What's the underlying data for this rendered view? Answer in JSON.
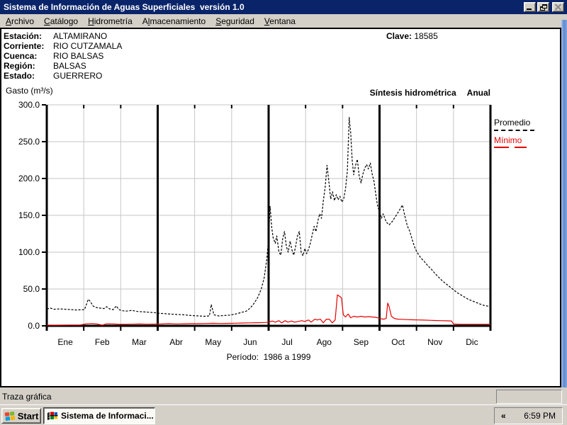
{
  "titlebar": {
    "title": "Sistema de Información de Aguas Superficiales  versión 1.0"
  },
  "menu": {
    "items": [
      {
        "label": "Archivo",
        "mnemonic": 0
      },
      {
        "label": "Catálogo",
        "mnemonic": 0
      },
      {
        "label": "Hidrometría",
        "mnemonic": 0
      },
      {
        "label": "Almacenamiento",
        "mnemonic": 1
      },
      {
        "label": "Seguridad",
        "mnemonic": 0
      },
      {
        "label": "Ventana",
        "mnemonic": 0
      }
    ]
  },
  "info": {
    "fields": [
      {
        "label": "Estación:",
        "value": "ALTAMIRANO"
      },
      {
        "label": "Corriente:",
        "value": "RIO CUTZAMALA"
      },
      {
        "label": "Cuenca:",
        "value": "RIO BALSAS"
      },
      {
        "label": "Región:",
        "value": "BALSAS"
      },
      {
        "label": "Estado:",
        "value": "GUERRERO"
      }
    ],
    "clave_label": "Clave:",
    "clave_value": "18585"
  },
  "chart": {
    "y_axis_title": "Gasto (m³/s)",
    "header_title": "Síntesis hidrométrica",
    "header_mode": "Anual",
    "period": "Período:  1986 a 1999",
    "legend_promedio": "Promedio",
    "legend_minimo": "Mínimo"
  },
  "chart_data": {
    "type": "line",
    "title": "Síntesis hidrométrica Anual",
    "ylabel": "Gasto (m³/s)",
    "xlabel": "",
    "ylim": [
      0,
      300
    ],
    "y_tick_values": [
      300,
      250,
      200,
      150,
      100,
      50,
      0
    ],
    "y_tick_labels": [
      "300.0",
      "250.0",
      "200.0",
      "150.0",
      "100.0",
      "50.0",
      "0.0"
    ],
    "categories": [
      "Ene",
      "Feb",
      "Mar",
      "Abr",
      "May",
      "Jun",
      "Jul",
      "Ago",
      "Sep",
      "Oct",
      "Nov",
      "Dic"
    ],
    "x_unit": "month, fractional 0-12",
    "quarter_separators": [
      3,
      6,
      9
    ],
    "grid": true,
    "legend_position": "right",
    "annotation": "Período: 1986 a 1999",
    "colors": {
      "promedio": "#000000",
      "minimo": "#e60000",
      "grid": "#c6c6c6"
    },
    "series": [
      {
        "name": "Promedio",
        "color": "#000000",
        "line_style": "dashed",
        "points": [
          [
            0.0,
            23
          ],
          [
            0.1,
            24
          ],
          [
            0.2,
            22.5
          ],
          [
            0.35,
            23
          ],
          [
            0.5,
            22.5
          ],
          [
            0.65,
            22
          ],
          [
            0.8,
            21.5
          ],
          [
            0.95,
            21.8
          ],
          [
            1.02,
            22
          ],
          [
            1.08,
            30
          ],
          [
            1.12,
            36
          ],
          [
            1.18,
            33
          ],
          [
            1.25,
            27
          ],
          [
            1.32,
            25
          ],
          [
            1.45,
            24
          ],
          [
            1.55,
            23.5
          ],
          [
            1.62,
            26
          ],
          [
            1.7,
            23
          ],
          [
            1.8,
            22
          ],
          [
            1.88,
            27
          ],
          [
            1.95,
            22
          ],
          [
            2.05,
            20.5
          ],
          [
            2.15,
            20
          ],
          [
            2.3,
            21
          ],
          [
            2.45,
            19.5
          ],
          [
            2.6,
            19
          ],
          [
            2.75,
            18.5
          ],
          [
            2.9,
            18
          ],
          [
            3.05,
            17
          ],
          [
            3.2,
            16.5
          ],
          [
            3.35,
            16
          ],
          [
            3.5,
            15.5
          ],
          [
            3.7,
            15
          ],
          [
            3.9,
            14
          ],
          [
            4.1,
            13.5
          ],
          [
            4.25,
            13
          ],
          [
            4.4,
            13.5
          ],
          [
            4.45,
            29
          ],
          [
            4.52,
            15
          ],
          [
            4.65,
            13.5
          ],
          [
            4.8,
            14
          ],
          [
            4.95,
            14.5
          ],
          [
            5.1,
            16
          ],
          [
            5.25,
            18
          ],
          [
            5.4,
            20
          ],
          [
            5.5,
            24
          ],
          [
            5.6,
            30
          ],
          [
            5.7,
            38
          ],
          [
            5.8,
            50
          ],
          [
            5.88,
            65
          ],
          [
            5.95,
            90
          ],
          [
            6.0,
            120
          ],
          [
            6.04,
            162
          ],
          [
            6.08,
            135
          ],
          [
            6.12,
            120
          ],
          [
            6.18,
            112
          ],
          [
            6.22,
            122
          ],
          [
            6.28,
            100
          ],
          [
            6.33,
            96
          ],
          [
            6.38,
            118
          ],
          [
            6.43,
            128
          ],
          [
            6.48,
            108
          ],
          [
            6.53,
            100
          ],
          [
            6.58,
            115
          ],
          [
            6.63,
            103
          ],
          [
            6.68,
            96
          ],
          [
            6.73,
            108
          ],
          [
            6.78,
            122
          ],
          [
            6.83,
            128
          ],
          [
            6.88,
            100
          ],
          [
            6.93,
            95
          ],
          [
            6.98,
            105
          ],
          [
            7.03,
            98
          ],
          [
            7.08,
            104
          ],
          [
            7.13,
            112
          ],
          [
            7.18,
            124
          ],
          [
            7.23,
            135
          ],
          [
            7.28,
            128
          ],
          [
            7.33,
            142
          ],
          [
            7.38,
            152
          ],
          [
            7.43,
            146
          ],
          [
            7.48,
            170
          ],
          [
            7.53,
            188
          ],
          [
            7.58,
            218
          ],
          [
            7.63,
            196
          ],
          [
            7.68,
            172
          ],
          [
            7.73,
            182
          ],
          [
            7.78,
            170
          ],
          [
            7.83,
            178
          ],
          [
            7.88,
            171
          ],
          [
            7.93,
            176
          ],
          [
            7.98,
            168
          ],
          [
            8.03,
            172
          ],
          [
            8.08,
            186
          ],
          [
            8.13,
            210
          ],
          [
            8.18,
            283
          ],
          [
            8.22,
            262
          ],
          [
            8.26,
            225
          ],
          [
            8.3,
            205
          ],
          [
            8.35,
            218
          ],
          [
            8.4,
            226
          ],
          [
            8.45,
            203
          ],
          [
            8.5,
            194
          ],
          [
            8.55,
            206
          ],
          [
            8.6,
            214
          ],
          [
            8.65,
            219
          ],
          [
            8.7,
            213
          ],
          [
            8.75,
            221
          ],
          [
            8.8,
            206
          ],
          [
            8.85,
            196
          ],
          [
            8.9,
            178
          ],
          [
            8.95,
            162
          ],
          [
            9.0,
            155
          ],
          [
            9.05,
            146
          ],
          [
            9.1,
            152
          ],
          [
            9.18,
            141
          ],
          [
            9.26,
            137
          ],
          [
            9.35,
            142
          ],
          [
            9.45,
            150
          ],
          [
            9.55,
            158
          ],
          [
            9.62,
            164
          ],
          [
            9.68,
            150
          ],
          [
            9.75,
            136
          ],
          [
            9.82,
            128
          ],
          [
            9.9,
            114
          ],
          [
            9.97,
            104
          ],
          [
            10.05,
            97
          ],
          [
            10.12,
            92
          ],
          [
            10.2,
            88
          ],
          [
            10.3,
            82
          ],
          [
            10.4,
            77
          ],
          [
            10.5,
            71
          ],
          [
            10.6,
            66
          ],
          [
            10.7,
            61
          ],
          [
            10.8,
            57
          ],
          [
            10.9,
            53
          ],
          [
            11.0,
            49
          ],
          [
            11.1,
            45
          ],
          [
            11.2,
            42
          ],
          [
            11.3,
            39
          ],
          [
            11.4,
            36
          ],
          [
            11.5,
            34
          ],
          [
            11.6,
            32
          ],
          [
            11.7,
            30
          ],
          [
            11.8,
            28
          ],
          [
            11.9,
            27
          ],
          [
            12.0,
            26
          ]
        ]
      },
      {
        "name": "Mínimo",
        "color": "#e60000",
        "line_style": "solid",
        "points": [
          [
            0.0,
            1
          ],
          [
            0.3,
            1
          ],
          [
            0.6,
            1.2
          ],
          [
            0.9,
            1.2
          ],
          [
            1.05,
            2.5
          ],
          [
            1.2,
            3
          ],
          [
            1.35,
            2.5
          ],
          [
            1.5,
            1
          ],
          [
            1.6,
            2.5
          ],
          [
            1.8,
            2.5
          ],
          [
            1.95,
            2
          ],
          [
            2.1,
            2
          ],
          [
            2.3,
            2.2
          ],
          [
            2.5,
            2.5
          ],
          [
            2.7,
            2.2
          ],
          [
            2.9,
            2.3
          ],
          [
            3.1,
            2.5
          ],
          [
            3.3,
            3
          ],
          [
            3.5,
            2.6
          ],
          [
            3.7,
            2.8
          ],
          [
            3.9,
            3
          ],
          [
            4.1,
            3
          ],
          [
            4.3,
            3.2
          ],
          [
            4.5,
            3.5
          ],
          [
            4.7,
            3.2
          ],
          [
            4.9,
            3.4
          ],
          [
            5.1,
            3.6
          ],
          [
            5.3,
            3.8
          ],
          [
            5.5,
            4
          ],
          [
            5.7,
            4.2
          ],
          [
            5.9,
            4.5
          ],
          [
            6.0,
            5
          ],
          [
            6.1,
            6.5
          ],
          [
            6.18,
            5
          ],
          [
            6.28,
            7
          ],
          [
            6.35,
            4
          ],
          [
            6.45,
            7
          ],
          [
            6.52,
            5
          ],
          [
            6.62,
            6.5
          ],
          [
            6.7,
            5
          ],
          [
            6.8,
            6
          ],
          [
            6.9,
            7
          ],
          [
            6.98,
            6
          ],
          [
            7.08,
            8
          ],
          [
            7.15,
            5
          ],
          [
            7.25,
            9
          ],
          [
            7.32,
            8
          ],
          [
            7.4,
            9
          ],
          [
            7.48,
            4
          ],
          [
            7.56,
            9
          ],
          [
            7.64,
            9
          ],
          [
            7.72,
            4
          ],
          [
            7.8,
            8
          ],
          [
            7.86,
            42
          ],
          [
            7.92,
            40
          ],
          [
            7.97,
            38
          ],
          [
            8.02,
            15
          ],
          [
            8.08,
            12
          ],
          [
            8.15,
            16
          ],
          [
            8.22,
            11
          ],
          [
            8.3,
            13
          ],
          [
            8.4,
            12
          ],
          [
            8.5,
            13
          ],
          [
            8.6,
            12
          ],
          [
            8.7,
            12.5
          ],
          [
            8.8,
            12
          ],
          [
            8.9,
            11.5
          ],
          [
            8.98,
            10.5
          ],
          [
            9.05,
            9.5
          ],
          [
            9.12,
            9
          ],
          [
            9.18,
            10
          ],
          [
            9.22,
            31
          ],
          [
            9.26,
            26
          ],
          [
            9.32,
            13
          ],
          [
            9.4,
            10
          ],
          [
            9.5,
            9
          ],
          [
            9.6,
            8.8
          ],
          [
            9.75,
            8.5
          ],
          [
            9.9,
            8.2
          ],
          [
            10.05,
            8
          ],
          [
            10.2,
            7.8
          ],
          [
            10.35,
            7.5
          ],
          [
            10.5,
            7.2
          ],
          [
            10.65,
            7
          ],
          [
            10.8,
            6.8
          ],
          [
            10.95,
            6.5
          ],
          [
            11.0,
            2.5
          ],
          [
            11.2,
            2
          ],
          [
            11.5,
            2
          ],
          [
            11.8,
            2
          ],
          [
            12.0,
            2
          ]
        ]
      }
    ]
  },
  "statusbar": {
    "text": "Traza gráfica"
  },
  "taskbar": {
    "start": "Start",
    "task": "Sistema de Informaci...",
    "chevron": "«",
    "clock": "6:59 PM"
  }
}
